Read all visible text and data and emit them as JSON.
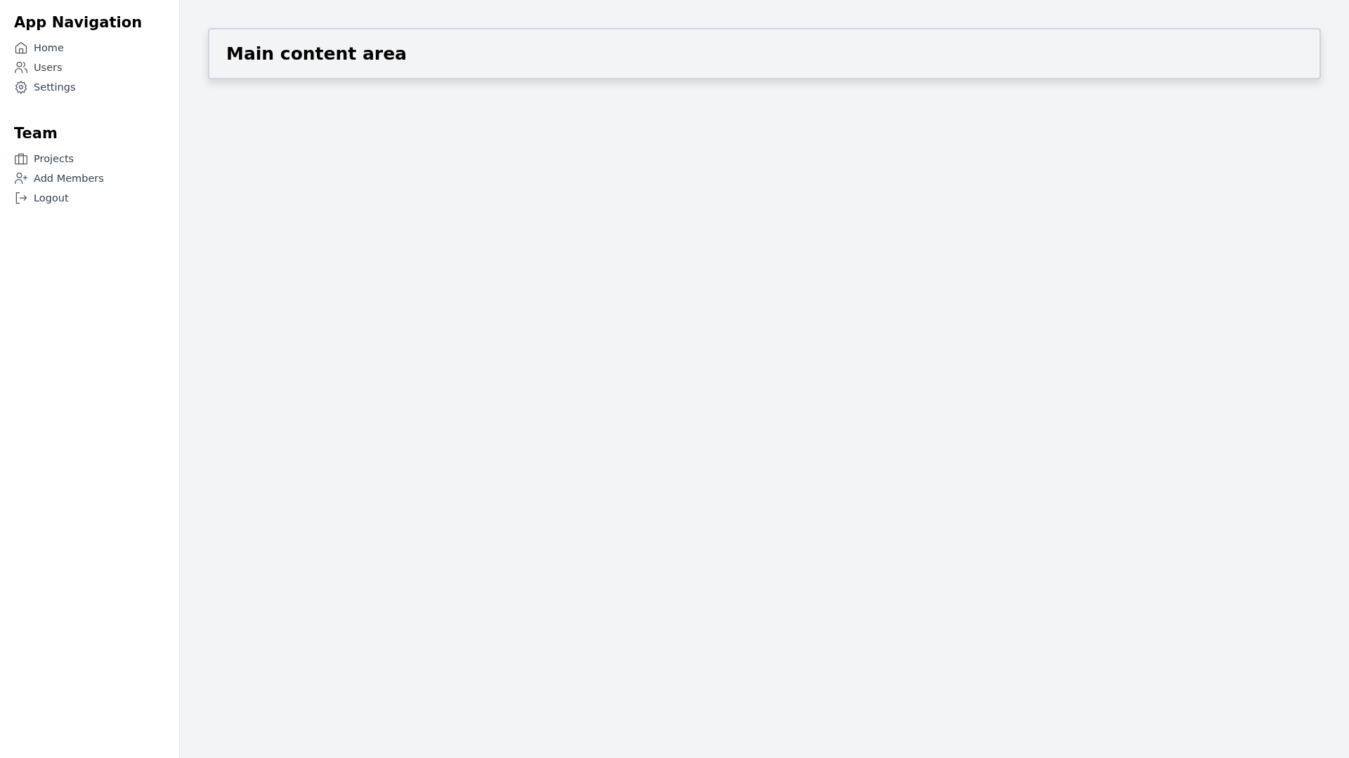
{
  "sidebar": {
    "sections": [
      {
        "title": "App Navigation",
        "items": [
          {
            "label": "Home"
          },
          {
            "label": "Users"
          },
          {
            "label": "Settings"
          }
        ]
      },
      {
        "title": "Team",
        "items": [
          {
            "label": "Projects"
          },
          {
            "label": "Add Members"
          },
          {
            "label": "Logout"
          }
        ]
      }
    ]
  },
  "main": {
    "card_title": "Main content area"
  }
}
